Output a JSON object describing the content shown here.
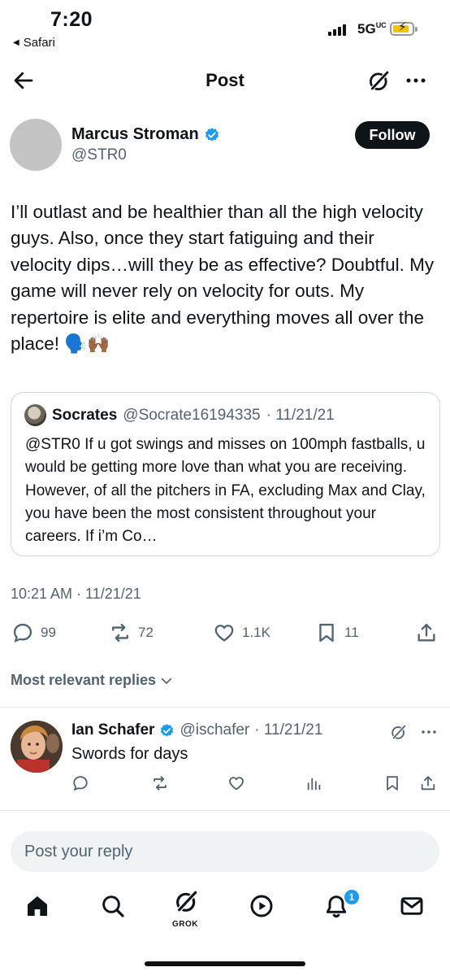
{
  "status_bar": {
    "time": "7:20",
    "back_app": "Safari",
    "network": "5G",
    "network_suffix": "UC"
  },
  "header": {
    "title": "Post",
    "icons": [
      "back-arrow-icon",
      "grok-icon",
      "more-icon"
    ]
  },
  "author": {
    "name": "Marcus Stroman",
    "handle": "@STR0",
    "verified": true,
    "follow_label": "Follow"
  },
  "tweet": {
    "text": "I’ll outlast and be healthier than all the high velocity guys. Also, once they start fatiguing and their velocity dips…will they be as effective? Doubtful. My game will never rely on velocity for outs. My repertoire is elite and everything moves all over the place! 🗣️🙌🏾",
    "timestamp": "10:21 AM · 11/21/21"
  },
  "quote": {
    "name": "Socrates",
    "handle": "@Socrate16194335",
    "date": "· 11/21/21",
    "text": "@STR0 If u got swings and misses on 100mph fastballs, u would be getting more love than what you are receiving.  However, of all the pitchers in FA, excluding Max and Clay, you have been the most consistent throughout your careers. If i’m Co…"
  },
  "actions": {
    "replies": "99",
    "reposts": "72",
    "likes": "1.1K",
    "bookmarks": "11"
  },
  "replies_filter": "Most relevant replies",
  "reply": {
    "name": "Ian Schafer",
    "handle": "@ischafer",
    "date": "· 11/21/21",
    "text": "Swords for days",
    "verified": true
  },
  "compose": {
    "placeholder": "Post your reply"
  },
  "tabbar": {
    "grok_label": "GROK",
    "notification_count": "1",
    "icons": [
      "home-icon",
      "search-icon",
      "grok-icon",
      "video-icon",
      "notifications-icon",
      "messages-icon"
    ]
  },
  "colors": {
    "text": "#0f1419",
    "secondary": "#536471",
    "accent": "#1d9bf0",
    "border": "#cfd9de"
  }
}
